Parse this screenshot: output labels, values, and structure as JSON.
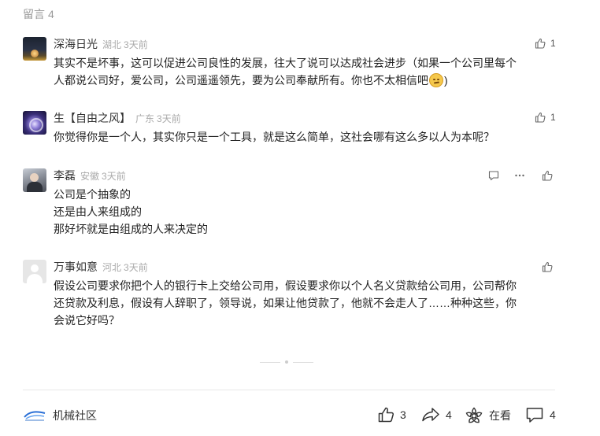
{
  "header": {
    "label": "留言",
    "count": "4"
  },
  "comments": [
    {
      "user": "深海日光",
      "location": "湖北",
      "time": "3天前",
      "likes": "1",
      "lines": [
        "其实不是坏事，这可以促进公司良性的发展，往大了说可以达成社会进步（如果一个公司里每个",
        "人都说公司好，爱公司，公司遥遥领先，要为公司奉献所有。你也不太相信吧",
        ")"
      ],
      "emoji": "sweat-smile-emoji"
    },
    {
      "user": "生【自由之风】",
      "location": "广东",
      "time": "3天前",
      "likes": "1",
      "lines": [
        "你觉得你是一个人，其实你只是一个工具，就是这么简单，这社会哪有这么多以人为本呢？"
      ]
    },
    {
      "user": "李磊",
      "location": "安徽",
      "time": "3天前",
      "likes": "",
      "lines": [
        "公司是个抽象的",
        "还是由人来组成的",
        "那好坏就是由组成的人来决定的"
      ]
    },
    {
      "user": "万事如意",
      "location": "河北",
      "time": "3天前",
      "likes": "",
      "lines": [
        "假设公司要求你把个人的银行卡上交给公司用，假设要求你以个人名义贷款给公司用，公司帮你",
        "还贷款及利息，假设有人辞职了，领导说，如果让他贷款了，他就不会走人了……种种这些，你",
        "会说它好吗？"
      ]
    }
  ],
  "footer": {
    "brand": "机械社区",
    "likes": "3",
    "shares": "4",
    "viewing_label": "在看",
    "comments": "4"
  },
  "colors": {
    "text": "#222222",
    "muted": "#aaaaaa",
    "icon": "#555555"
  }
}
